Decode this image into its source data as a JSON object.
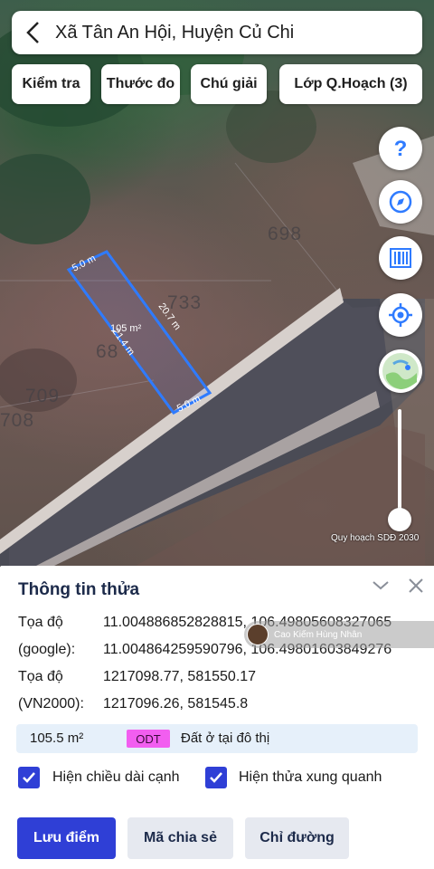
{
  "header": {
    "title": "Xã Tân An Hội, Huyện Củ Chi"
  },
  "tools": [
    "Kiểm tra",
    "Thước đo",
    "Chú giải",
    "Lớp Q.Hoạch (3)"
  ],
  "map": {
    "parcel_labels": [
      "698",
      "733",
      "68",
      "709",
      "708"
    ],
    "edge_top": "5.0 m",
    "edge_right": "20.7 m",
    "edge_bottom": "5.0 m",
    "edge_left": "21.4 m",
    "area_label": "105 m²",
    "plan_label": "Quy hoạch SDĐ 2030",
    "plan_slider_level": 1.0
  },
  "right_controls": [
    "help-icon",
    "compass-icon",
    "barcode-icon",
    "locate-icon",
    "map-layer-icon"
  ],
  "sheet": {
    "title": "Thông tin thửa",
    "coord_label_1": "Tọa độ",
    "coord_label_1b": "(google):",
    "coord_google_1": "11.004886852828815, 106.49805608327065",
    "coord_google_2": "11.00486425959079​6, 106.4980160384927​6",
    "coord_label_2": "Tọa độ",
    "coord_label_2b": "(VN2000):",
    "coord_vn2000_1": "1217098.77, 581550.17",
    "coord_vn2000_2": "1217096.26, 581545.8",
    "author": "Cao Kiếm Hùng Nhân",
    "area": "105.5 m²",
    "land_code": "ODT",
    "land_use": "Đất ở tại đô thị",
    "check_edges": "Hiện chiều dài cạnh",
    "check_neighbors": "Hiện thửa xung quanh",
    "btn_save": "Lưu điểm",
    "btn_share": "Mã chia sẻ",
    "btn_route": "Chỉ đường"
  },
  "colors": {
    "accent": "#2f3fd6",
    "parcel_outline": "#2f7bff",
    "odt_badge": "#f25ef0"
  }
}
